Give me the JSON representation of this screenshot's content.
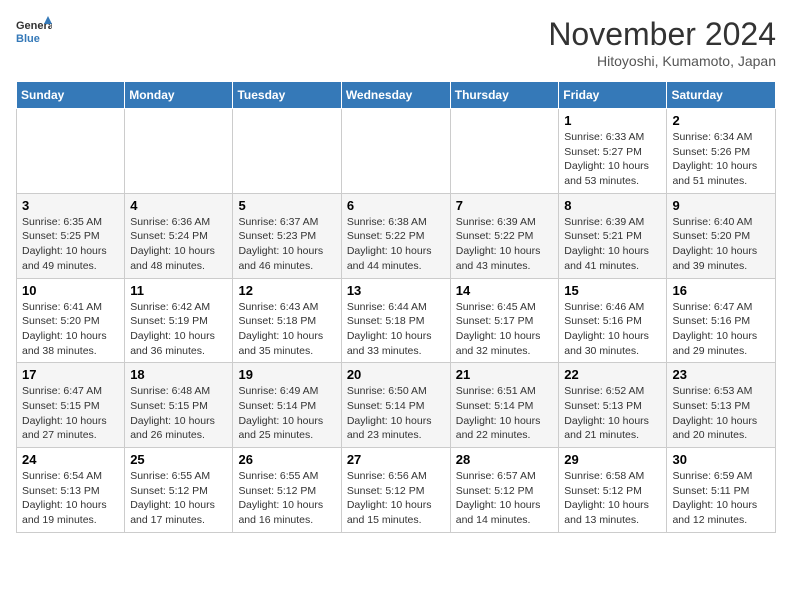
{
  "header": {
    "logo_line1": "General",
    "logo_line2": "Blue",
    "month": "November 2024",
    "location": "Hitoyoshi, Kumamoto, Japan"
  },
  "weekdays": [
    "Sunday",
    "Monday",
    "Tuesday",
    "Wednesday",
    "Thursday",
    "Friday",
    "Saturday"
  ],
  "weeks": [
    [
      {
        "day": "",
        "info": ""
      },
      {
        "day": "",
        "info": ""
      },
      {
        "day": "",
        "info": ""
      },
      {
        "day": "",
        "info": ""
      },
      {
        "day": "",
        "info": ""
      },
      {
        "day": "1",
        "info": "Sunrise: 6:33 AM\nSunset: 5:27 PM\nDaylight: 10 hours\nand 53 minutes."
      },
      {
        "day": "2",
        "info": "Sunrise: 6:34 AM\nSunset: 5:26 PM\nDaylight: 10 hours\nand 51 minutes."
      }
    ],
    [
      {
        "day": "3",
        "info": "Sunrise: 6:35 AM\nSunset: 5:25 PM\nDaylight: 10 hours\nand 49 minutes."
      },
      {
        "day": "4",
        "info": "Sunrise: 6:36 AM\nSunset: 5:24 PM\nDaylight: 10 hours\nand 48 minutes."
      },
      {
        "day": "5",
        "info": "Sunrise: 6:37 AM\nSunset: 5:23 PM\nDaylight: 10 hours\nand 46 minutes."
      },
      {
        "day": "6",
        "info": "Sunrise: 6:38 AM\nSunset: 5:22 PM\nDaylight: 10 hours\nand 44 minutes."
      },
      {
        "day": "7",
        "info": "Sunrise: 6:39 AM\nSunset: 5:22 PM\nDaylight: 10 hours\nand 43 minutes."
      },
      {
        "day": "8",
        "info": "Sunrise: 6:39 AM\nSunset: 5:21 PM\nDaylight: 10 hours\nand 41 minutes."
      },
      {
        "day": "9",
        "info": "Sunrise: 6:40 AM\nSunset: 5:20 PM\nDaylight: 10 hours\nand 39 minutes."
      }
    ],
    [
      {
        "day": "10",
        "info": "Sunrise: 6:41 AM\nSunset: 5:20 PM\nDaylight: 10 hours\nand 38 minutes."
      },
      {
        "day": "11",
        "info": "Sunrise: 6:42 AM\nSunset: 5:19 PM\nDaylight: 10 hours\nand 36 minutes."
      },
      {
        "day": "12",
        "info": "Sunrise: 6:43 AM\nSunset: 5:18 PM\nDaylight: 10 hours\nand 35 minutes."
      },
      {
        "day": "13",
        "info": "Sunrise: 6:44 AM\nSunset: 5:18 PM\nDaylight: 10 hours\nand 33 minutes."
      },
      {
        "day": "14",
        "info": "Sunrise: 6:45 AM\nSunset: 5:17 PM\nDaylight: 10 hours\nand 32 minutes."
      },
      {
        "day": "15",
        "info": "Sunrise: 6:46 AM\nSunset: 5:16 PM\nDaylight: 10 hours\nand 30 minutes."
      },
      {
        "day": "16",
        "info": "Sunrise: 6:47 AM\nSunset: 5:16 PM\nDaylight: 10 hours\nand 29 minutes."
      }
    ],
    [
      {
        "day": "17",
        "info": "Sunrise: 6:47 AM\nSunset: 5:15 PM\nDaylight: 10 hours\nand 27 minutes."
      },
      {
        "day": "18",
        "info": "Sunrise: 6:48 AM\nSunset: 5:15 PM\nDaylight: 10 hours\nand 26 minutes."
      },
      {
        "day": "19",
        "info": "Sunrise: 6:49 AM\nSunset: 5:14 PM\nDaylight: 10 hours\nand 25 minutes."
      },
      {
        "day": "20",
        "info": "Sunrise: 6:50 AM\nSunset: 5:14 PM\nDaylight: 10 hours\nand 23 minutes."
      },
      {
        "day": "21",
        "info": "Sunrise: 6:51 AM\nSunset: 5:14 PM\nDaylight: 10 hours\nand 22 minutes."
      },
      {
        "day": "22",
        "info": "Sunrise: 6:52 AM\nSunset: 5:13 PM\nDaylight: 10 hours\nand 21 minutes."
      },
      {
        "day": "23",
        "info": "Sunrise: 6:53 AM\nSunset: 5:13 PM\nDaylight: 10 hours\nand 20 minutes."
      }
    ],
    [
      {
        "day": "24",
        "info": "Sunrise: 6:54 AM\nSunset: 5:13 PM\nDaylight: 10 hours\nand 19 minutes."
      },
      {
        "day": "25",
        "info": "Sunrise: 6:55 AM\nSunset: 5:12 PM\nDaylight: 10 hours\nand 17 minutes."
      },
      {
        "day": "26",
        "info": "Sunrise: 6:55 AM\nSunset: 5:12 PM\nDaylight: 10 hours\nand 16 minutes."
      },
      {
        "day": "27",
        "info": "Sunrise: 6:56 AM\nSunset: 5:12 PM\nDaylight: 10 hours\nand 15 minutes."
      },
      {
        "day": "28",
        "info": "Sunrise: 6:57 AM\nSunset: 5:12 PM\nDaylight: 10 hours\nand 14 minutes."
      },
      {
        "day": "29",
        "info": "Sunrise: 6:58 AM\nSunset: 5:12 PM\nDaylight: 10 hours\nand 13 minutes."
      },
      {
        "day": "30",
        "info": "Sunrise: 6:59 AM\nSunset: 5:11 PM\nDaylight: 10 hours\nand 12 minutes."
      }
    ]
  ]
}
